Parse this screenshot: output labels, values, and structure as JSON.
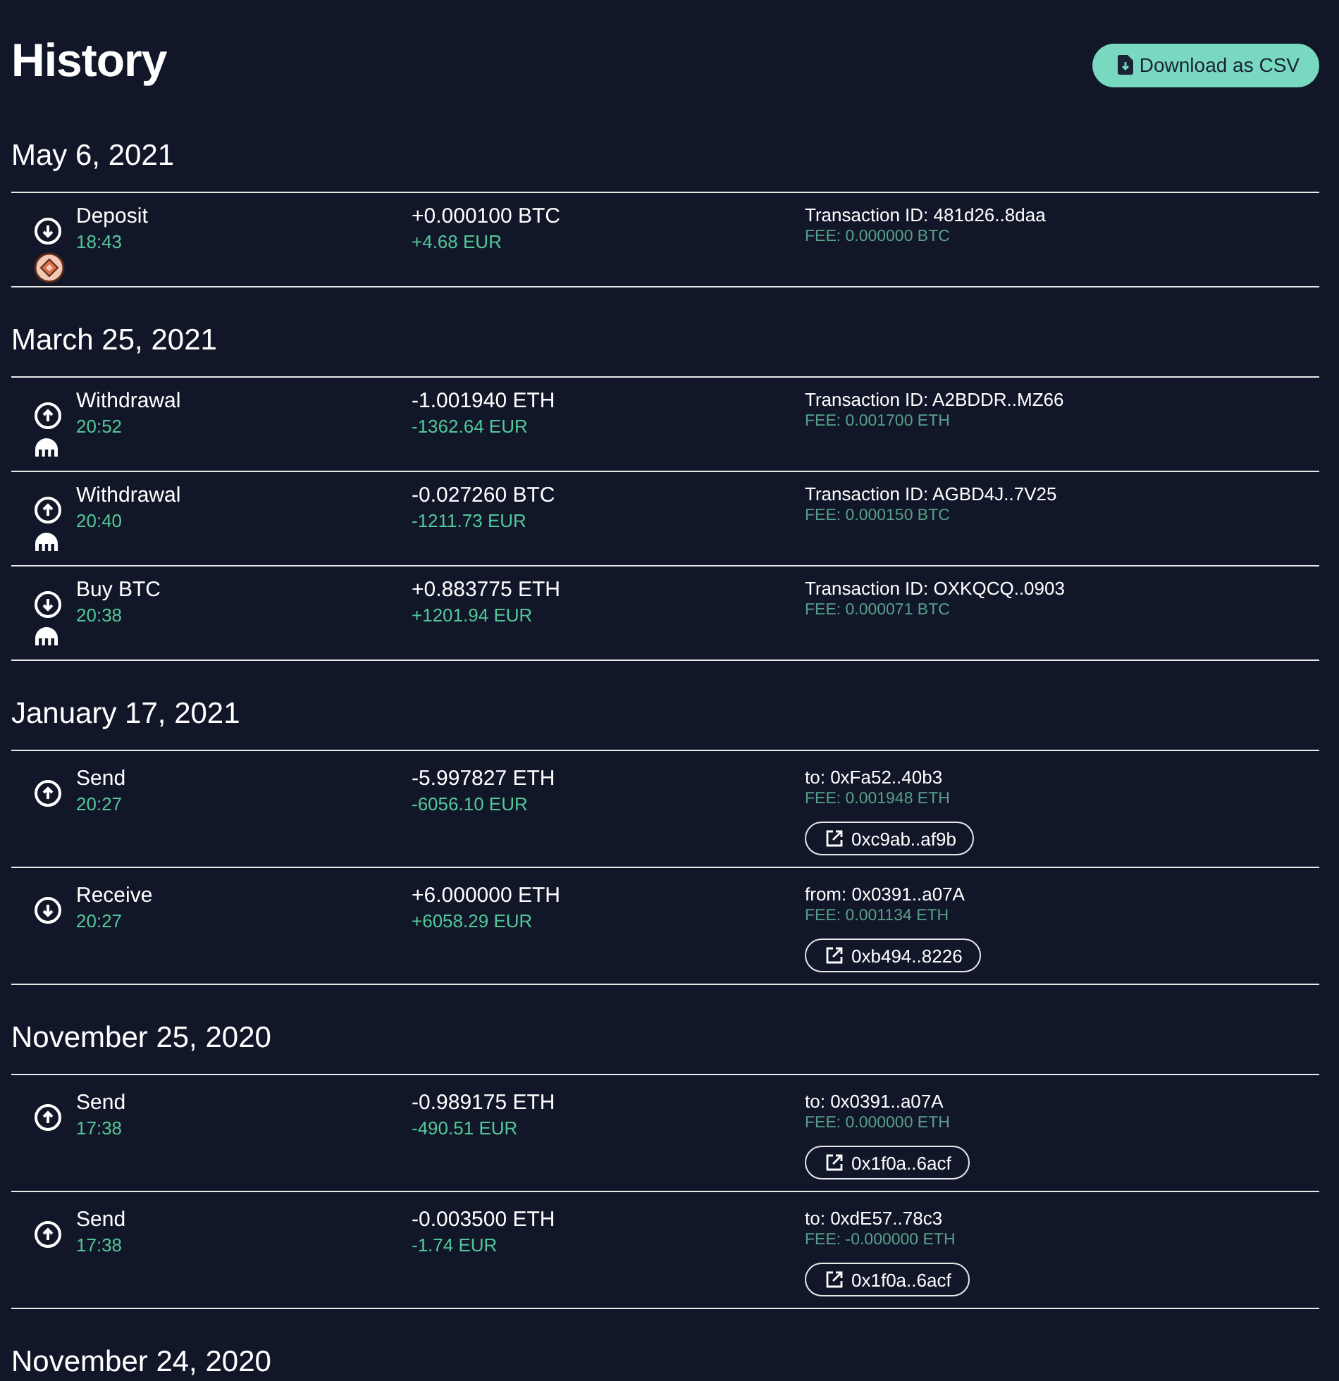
{
  "title": "History",
  "download_button": "Download as CSV",
  "groups": [
    {
      "date": "May 6, 2021",
      "transactions": [
        {
          "kind": "in",
          "badge": {
            "kind": "coin"
          },
          "type": "Deposit",
          "time": "18:43",
          "amount": "+0.000100 BTC",
          "fiat": "+4.68 EUR",
          "detail": "Transaction ID: 481d26..8daa",
          "fee": "FEE: 0.000000 BTC"
        }
      ]
    },
    {
      "date": "March 25, 2021",
      "transactions": [
        {
          "kind": "out",
          "badge": {
            "kind": "exchange"
          },
          "type": "Withdrawal",
          "time": "20:52",
          "amount": "-1.001940 ETH",
          "fiat": "-1362.64 EUR",
          "detail": "Transaction ID: A2BDDR..MZ66",
          "fee": "FEE: 0.001700 ETH"
        },
        {
          "kind": "out",
          "badge": {
            "kind": "exchange"
          },
          "type": "Withdrawal",
          "time": "20:40",
          "amount": "-0.027260 BTC",
          "fiat": "-1211.73 EUR",
          "detail": "Transaction ID: AGBD4J..7V25",
          "fee": "FEE: 0.000150 BTC"
        },
        {
          "kind": "in",
          "badge": {
            "kind": "exchange"
          },
          "type": "Buy BTC",
          "time": "20:38",
          "amount": "+0.883775 ETH",
          "fiat": "+1201.94 EUR",
          "detail": "Transaction ID: OXKQCQ..0903",
          "fee": "FEE: 0.000071 BTC"
        }
      ]
    },
    {
      "date": "January 17, 2021",
      "transactions": [
        {
          "kind": "out",
          "type": "Send",
          "time": "20:27",
          "amount": "-5.997827 ETH",
          "fiat": "-6056.10 EUR",
          "detail": "to: 0xFa52..40b3",
          "fee": "FEE: 0.001948 ETH",
          "link": "0xc9ab..af9b"
        },
        {
          "kind": "in",
          "type": "Receive",
          "time": "20:27",
          "amount": "+6.000000 ETH",
          "fiat": "+6058.29 EUR",
          "detail": "from: 0x0391..a07A",
          "fee": "FEE: 0.001134 ETH",
          "link": "0xb494..8226"
        }
      ]
    },
    {
      "date": "November 25, 2020",
      "transactions": [
        {
          "kind": "out",
          "type": "Send",
          "time": "17:38",
          "amount": "-0.989175 ETH",
          "fiat": "-490.51 EUR",
          "detail": "to: 0x0391..a07A",
          "fee": "FEE: 0.000000 ETH",
          "link": "0x1f0a..6acf"
        },
        {
          "kind": "out",
          "type": "Send",
          "time": "17:38",
          "amount": "-0.003500 ETH",
          "fiat": "-1.74 EUR",
          "detail": "to: 0xdE57..78c3",
          "fee": "FEE: -0.000000 ETH",
          "link": "0x1f0a..6acf"
        }
      ]
    },
    {
      "date": "November 24, 2020"
    }
  ]
}
